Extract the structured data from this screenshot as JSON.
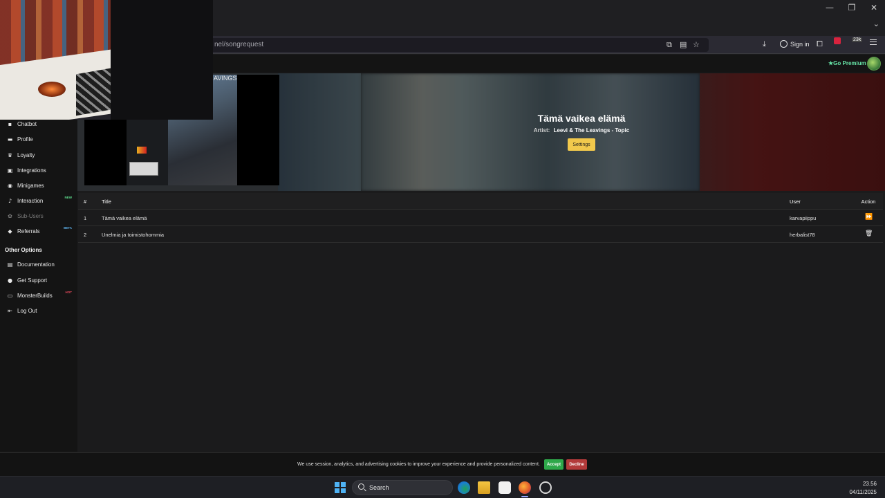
{
  "browser": {
    "url_partial": "nel/songrequest",
    "signin_label": "Sign in",
    "extension_count": "23k"
  },
  "header": {
    "premium_label": "Go Premium"
  },
  "sidebar": {
    "items": [
      {
        "label": "Chatbot",
        "icon": "chat-icon",
        "glyph": "▪"
      },
      {
        "label": "Profile",
        "icon": "profile-icon",
        "glyph": "▬"
      },
      {
        "label": "Loyalty",
        "icon": "trophy-icon",
        "glyph": "♛"
      },
      {
        "label": "Integrations",
        "icon": "integrations-icon",
        "glyph": "▣"
      },
      {
        "label": "Minigames",
        "icon": "gamepad-icon",
        "glyph": "◉"
      },
      {
        "label": "Interaction",
        "icon": "music-icon",
        "glyph": "♪",
        "tag": "NEW"
      },
      {
        "label": "Sub-Users",
        "icon": "sub-users-icon",
        "glyph": "✿",
        "disabled": true
      },
      {
        "label": "Referrals",
        "icon": "referrals-icon",
        "glyph": "◆",
        "tag": "BETA"
      }
    ],
    "other_heading": "Other Options",
    "other_items": [
      {
        "label": "Documentation",
        "icon": "documentation-icon",
        "glyph": "▤"
      },
      {
        "label": "Get Support",
        "icon": "support-icon",
        "glyph": "●"
      },
      {
        "label": "MonsterBuilds",
        "icon": "monitor-icon",
        "glyph": "▭",
        "tag": "HOT"
      },
      {
        "label": "Log Out",
        "icon": "logout-icon",
        "glyph": "⇤"
      }
    ]
  },
  "player": {
    "video_caption": "AVINGS",
    "now_playing_title": "Tämä vaikea elämä",
    "artist_label": "Artist:",
    "artist": "Leevi & The Leavings - Topic",
    "settings_label": "Settings"
  },
  "queue": {
    "headers": {
      "num": "#",
      "title": "Title",
      "user": "User",
      "action": "Action"
    },
    "rows": [
      {
        "num": "1",
        "title": "Tämä vaikea elämä",
        "user": "karvapiippu",
        "action_icon": "skip-icon"
      },
      {
        "num": "2",
        "title": "Unelmia ja toimistohommia",
        "user": "herbalist78",
        "action_icon": "trash-icon"
      }
    ]
  },
  "cookie": {
    "text": "We use session, analytics, and advertising cookies to improve your experience and provide personalized content.",
    "accept_label": "Accept",
    "decline_label": "Decline"
  },
  "taskbar": {
    "search_label": "Search",
    "time": "23.56",
    "date": "04/11/2025"
  },
  "colors": {
    "accent": "#f2c94c",
    "premium": "#67e5a8",
    "accept": "#2ea84a",
    "decline": "#b33a3a"
  }
}
